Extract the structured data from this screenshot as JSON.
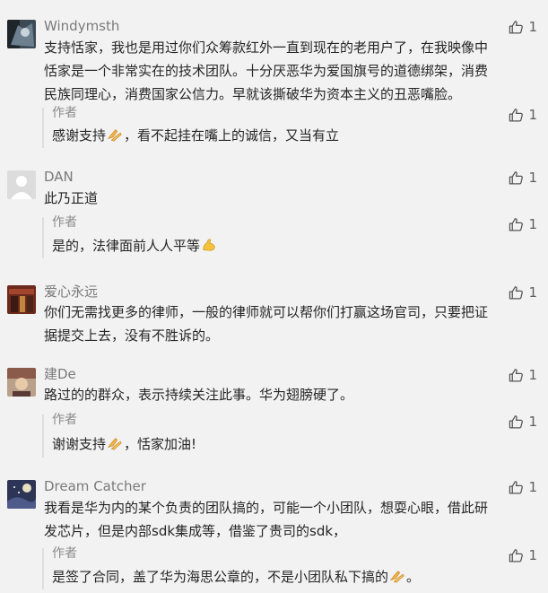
{
  "comments": [
    {
      "nickname": "Windymsth",
      "likes": "1",
      "text_line1": "支持恬家，我也是用过你们众筹款红外一直到现在的老用户了，在我映像中",
      "text_line2": "恬家是一个非常实在的技术团队。十分厌恶华为爱国旗号的道德绑架，消费",
      "text_line3": "民族同理心，消费国家公信力。早就该撕破华为资本主义的丑恶嘴脸。",
      "reply": {
        "author": "作者",
        "likes": "1",
        "text_before": "感谢支持",
        "emoji": "folded-hands-emoji",
        "text_after": "，看不起挂在嘴上的诚信，又当有立"
      }
    },
    {
      "nickname": "DAN",
      "likes": "1",
      "text_line1": "此乃正道",
      "reply": {
        "author": "作者",
        "likes": "1",
        "text_before": "是的，法律面前人人平等",
        "emoji": "flexed-biceps-emoji",
        "text_after": ""
      }
    },
    {
      "nickname": "爱心永远",
      "likes": "1",
      "text_line1": "你们无需找更多的律师，一般的律师就可以帮你们打赢这场官司，只要把证",
      "text_line2": "据提交上去，没有不胜诉的。"
    },
    {
      "nickname": "建De",
      "likes": "1",
      "text_line1": "路过的的群众，表示持续关注此事。华为翅膀硬了。",
      "reply": {
        "author": "作者",
        "likes": "1",
        "text_before": "谢谢支持",
        "emoji": "folded-hands-emoji",
        "text_after": "，恬家加油!"
      }
    },
    {
      "nickname": "Dream Catcher",
      "likes": "1",
      "text_line1": "我看是华为内的某个负责的团队搞的，可能一个小团队，想耍心眼，借此研",
      "text_line2": "发芯片，但是内部sdk集成等，借鉴了贵司的sdk，",
      "reply": {
        "author": "作者",
        "likes": "1",
        "text_before": "是签了合同，盖了华为海思公章的，不是小团队私下搞的",
        "emoji": "folded-hands-emoji",
        "text_after": "。"
      }
    }
  ],
  "icons": {
    "like": "thumbs-up-outline-icon"
  },
  "colors": {
    "background": "#f2f2f2",
    "nickname": "#7a7a7a",
    "text": "#252525",
    "reply_border": "#dedede"
  }
}
